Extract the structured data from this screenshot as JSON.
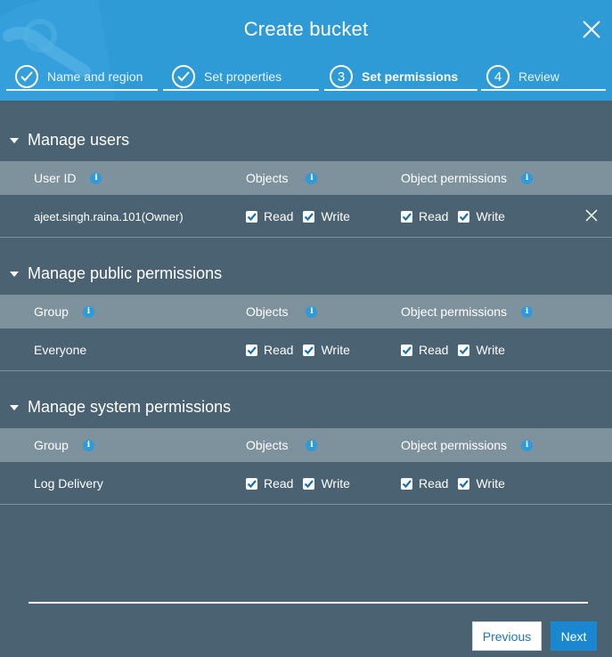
{
  "modal": {
    "title": "Create bucket",
    "close_icon": "close-icon"
  },
  "steps": [
    {
      "label": "Name and region",
      "number": "",
      "state": "done"
    },
    {
      "label": "Set properties",
      "number": "",
      "state": "done"
    },
    {
      "label": "Set permissions",
      "number": "3",
      "state": "active"
    },
    {
      "label": "Review",
      "number": "4",
      "state": "pending"
    }
  ],
  "columns": {
    "objects": "Objects",
    "object_permissions": "Object permissions"
  },
  "permissions": {
    "read": "Read",
    "write": "Write"
  },
  "sections": [
    {
      "title": "Manage users",
      "first_col": "User ID",
      "row": {
        "name": "ajeet.singh.raina.101(Owner)",
        "removable": true,
        "objects_read": true,
        "objects_write": true,
        "perm_read": true,
        "perm_write": true
      }
    },
    {
      "title": "Manage public permissions",
      "first_col": "Group",
      "row": {
        "name": "Everyone",
        "removable": false,
        "objects_read": true,
        "objects_write": true,
        "perm_read": true,
        "perm_write": true
      }
    },
    {
      "title": "Manage system permissions",
      "first_col": "Group",
      "row": {
        "name": "Log Delivery",
        "removable": false,
        "objects_read": true,
        "objects_write": true,
        "perm_read": true,
        "perm_write": true
      }
    }
  ],
  "buttons": {
    "previous": "Previous",
    "next": "Next"
  },
  "colors": {
    "header_bg": "#2e9ad6",
    "body_bg": "#4a6271",
    "table_head_bg": "#7e929e",
    "accent": "#1a87d0",
    "checkbox_check": "#1a6fb0"
  }
}
